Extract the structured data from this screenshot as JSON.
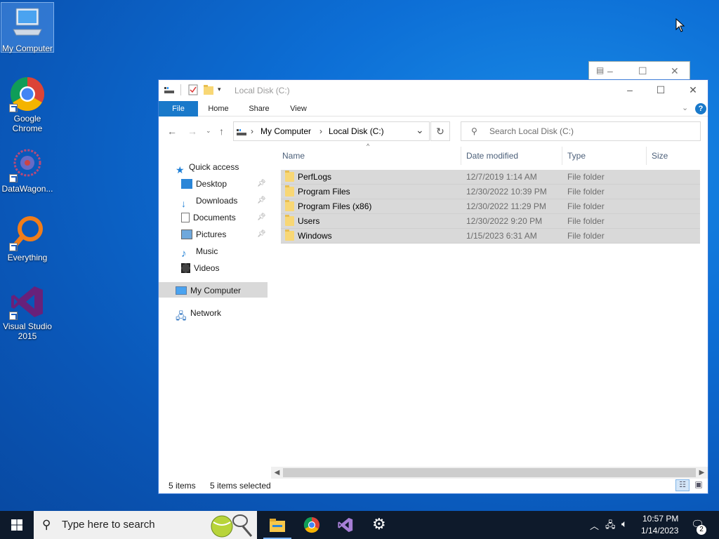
{
  "desktop": {
    "icons": [
      {
        "label": "My Computer",
        "icon": "computer-icon"
      },
      {
        "label": "Google Chrome",
        "icon": "chrome-icon"
      },
      {
        "label": "DataWagon...",
        "icon": "datawagon-icon"
      },
      {
        "label": "Everything",
        "icon": "everything-search-icon"
      },
      {
        "label": "Visual Studio 2015",
        "icon": "visual-studio-icon"
      }
    ]
  },
  "window": {
    "title": "Local Disk (C:)",
    "ribbon_tabs": [
      "File",
      "Home",
      "Share",
      "View"
    ],
    "address": {
      "crumbs": [
        "My Computer",
        "Local Disk (C:)"
      ]
    },
    "search_placeholder": "Search Local Disk (C:)",
    "nav": {
      "quick_access": "Quick access",
      "items": [
        "Desktop",
        "Downloads",
        "Documents",
        "Pictures",
        "Music",
        "Videos"
      ],
      "my_computer": "My Computer",
      "network": "Network"
    },
    "columns": [
      "Name",
      "Date modified",
      "Type",
      "Size"
    ],
    "files": [
      {
        "name": "PerfLogs",
        "date": "12/7/2019 1:14 AM",
        "type": "File folder"
      },
      {
        "name": "Program Files",
        "date": "12/30/2022 10:39 PM",
        "type": "File folder"
      },
      {
        "name": "Program Files (x86)",
        "date": "12/30/2022 11:29 PM",
        "type": "File folder"
      },
      {
        "name": "Users",
        "date": "12/30/2022 9:20 PM",
        "type": "File folder"
      },
      {
        "name": "Windows",
        "date": "1/15/2023 6:31 AM",
        "type": "File folder"
      }
    ],
    "status": {
      "items": "5 items",
      "selected": "5 items selected"
    }
  },
  "taskbar": {
    "search_placeholder": "Type here to search",
    "time": "10:57 PM",
    "date": "1/14/2023",
    "notification_count": "2"
  },
  "colors": {
    "accent": "#1979ca",
    "selection": "#d9d9d9",
    "taskbar": "#0e1a2b"
  }
}
